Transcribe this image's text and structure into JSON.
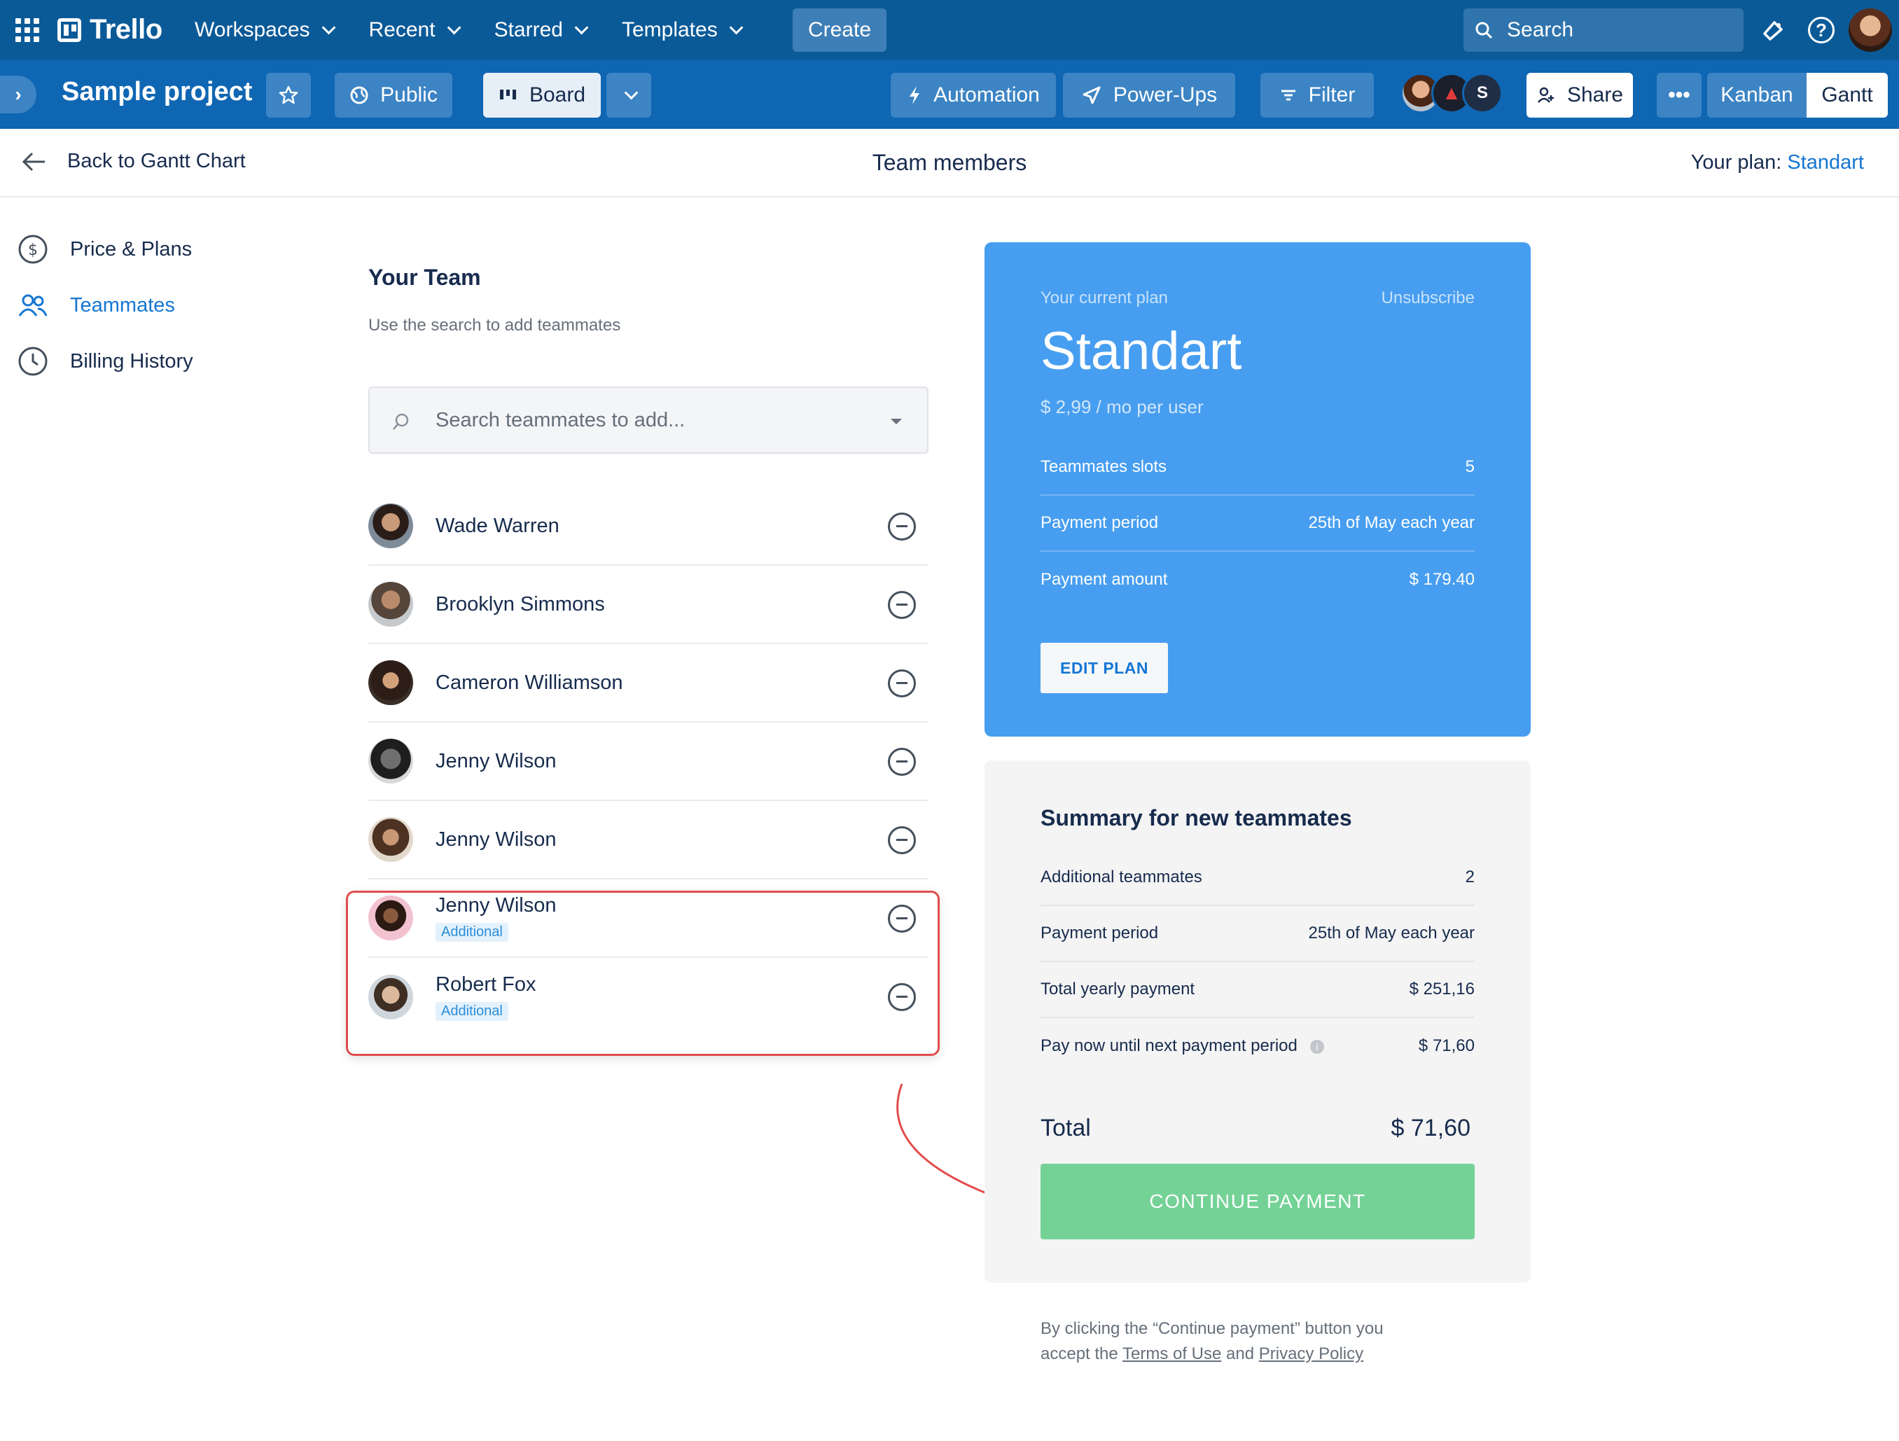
{
  "topnav": {
    "brand": "Trello",
    "menu": [
      {
        "label": "Workspaces"
      },
      {
        "label": "Recent"
      },
      {
        "label": "Starred"
      },
      {
        "label": "Templates"
      }
    ],
    "create_label": "Create",
    "search_label": "Search"
  },
  "boardbar": {
    "title": "Sample project",
    "visibility_label": "Public",
    "board_label": "Board",
    "automation_label": "Automation",
    "powerups_label": "Power-Ups",
    "filter_label": "Filter",
    "member_initial": "S",
    "share_label": "Share",
    "more_label": "•••",
    "views": [
      {
        "label": "Kanban"
      },
      {
        "label": "Gantt"
      }
    ]
  },
  "subheader": {
    "back_label": "Back to Gantt Chart",
    "title": "Team members",
    "plan_prefix": "Your plan:",
    "plan_name": "Standart"
  },
  "sidebar": {
    "items": [
      {
        "label": "Price & Plans"
      },
      {
        "label": "Teammates"
      },
      {
        "label": "Billing History"
      }
    ]
  },
  "team": {
    "title": "Your Team",
    "subtitle": "Use the search to add teammates",
    "search_placeholder": "Search teammates to add...",
    "members": [
      {
        "name": "Wade Warren",
        "badge": ""
      },
      {
        "name": "Brooklyn Simmons",
        "badge": ""
      },
      {
        "name": "Cameron Williamson",
        "badge": ""
      },
      {
        "name": "Jenny Wilson",
        "badge": ""
      },
      {
        "name": "Jenny Wilson",
        "badge": ""
      },
      {
        "name": "Jenny Wilson",
        "badge": "Additional"
      },
      {
        "name": "Robert Fox",
        "badge": "Additional"
      }
    ]
  },
  "plan": {
    "current_label": "Your current plan",
    "unsubscribe_label": "Unsubscribe",
    "name": "Standart",
    "price": "$ 2,99 / mo per user",
    "rows": [
      {
        "label": "Teammates slots",
        "value": "5"
      },
      {
        "label": "Payment period",
        "value": "25th of May each year"
      },
      {
        "label": "Payment amount",
        "value": "$ 179.40"
      }
    ],
    "edit_label": "EDIT PLAN"
  },
  "summary": {
    "title": "Summary for new teammates",
    "rows": [
      {
        "label": "Additional teammates",
        "value": "2"
      },
      {
        "label": "Payment period",
        "value": "25th of May each year"
      },
      {
        "label": "Total yearly payment",
        "value": "$ 251,16"
      },
      {
        "label": "Pay now until next payment period",
        "value": "$ 71,60"
      }
    ],
    "info_glyph": "i",
    "total_label": "Total",
    "total_value": "$ 71,60",
    "continue_label": "CONTINUE PAYMENT"
  },
  "disclaimer": {
    "line1": "By clicking the “Continue payment” button you",
    "prefix": "accept the",
    "terms": "Terms of Use",
    "and": "and",
    "privacy": "Privacy Policy"
  },
  "colors": {
    "nav": "#0b5a98",
    "boardbar": "#0f66b3",
    "accent": "#1676d2",
    "plan_card": "#479ef0",
    "continue": "#74d296",
    "highlight": "#e24c4c"
  }
}
